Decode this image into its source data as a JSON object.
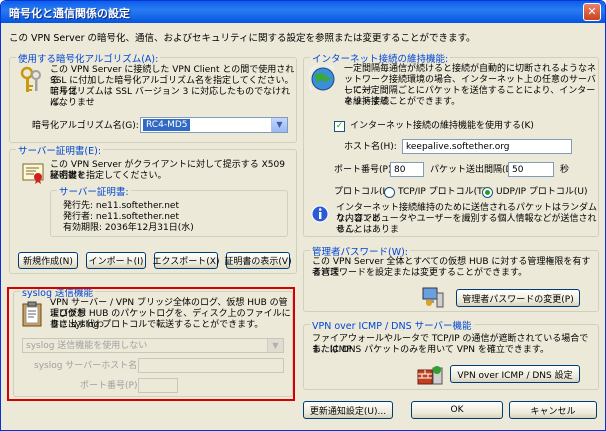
{
  "window": {
    "title": "暗号化と通信関係の設定",
    "close_glyph": "✕",
    "description": "この VPN Server の暗号化、通信、およびセキュリティに関する設定を参照または変更することができます。"
  },
  "encryption": {
    "group_title": "使用する暗号化アルゴリズム(A):",
    "text": [
      "この VPN Server に接続した VPN Client との間で使用される",
      "SSL に付加した暗号化アルゴリズム名を指定してください。暗号化",
      "アルゴリズムは SSL バージョン 3 に対応したものでなければなりませ",
      "ん。"
    ],
    "algorithm_label": "暗号化アルゴリズム名(G):",
    "algorithm_value": "RC4-MD5"
  },
  "certificate": {
    "group_title": "サーバー証明書(E):",
    "text": [
      "この VPN Server がクライアントに対して提示する X509 証明書と",
      "秘密鍵を指定してください。"
    ],
    "subgroup_title": "サーバー証明書:",
    "issued_to": "発行先: ne11.softether.net",
    "issuer": "発行者: ne11.softether.net",
    "expires": "有効期限: 2036年12月31日(水)",
    "buttons": [
      "新規作成(N)",
      "インポート(I)",
      "エクスポート(X)",
      "証明書の表示(V)"
    ]
  },
  "syslog": {
    "group_title": "syslog 送信機能",
    "text": [
      "VPN サーバー / VPN ブリッジ全体のログ、仮想 HUB の管理ログお",
      "よび仮想 HUB のパケットログを、ディスク上のファイルに書き出す代わ",
      "りに syslog プロトコルで転送することができます。"
    ],
    "mode_value": "syslog 送信機能を使用しない",
    "host_label": "syslog サーバーホスト名(S):",
    "host_value": "",
    "port_label": "ポート番号(P):",
    "port_value": ""
  },
  "keepalive": {
    "group_title": "インターネット接続の維持機能:",
    "text": [
      "一定間隔毎通信が続けると接続が自動的に切断されるようなネ",
      "ットワーク接続環境の場合、インターネット上の任意のサーバーに対",
      "して一定間隔ごとにパケットを送信することにより、インターネット接続",
      "を維持することができます。"
    ],
    "checkbox_label": "インターネット接続の維持機能を使用する(K)",
    "checked_glyph": "✓",
    "host_label": "ホスト名(H):",
    "host_value": "keepalive.softether.org",
    "port_label": "ポート番号(P):",
    "port_value": "80",
    "interval_label": "パケット送出間隔(D):",
    "interval_value": "50",
    "interval_unit": "秒",
    "protocol_label": "プロトコル(L):",
    "tcp_label": "TCP/IP プロトコル(T)",
    "udp_label": "UDP/IP プロトコル(U)",
    "note": [
      "インターネット接続維持のために送信されるパケットはランダムな内容であ",
      "り、コンピュータやユーザーを識別する個人情報などが送信されることはありま",
      "せん。"
    ]
  },
  "admin": {
    "group_title": "管理者パスワード(W):",
    "text": [
      "この VPN Server 全体とすべての仮想 HUB に対する管理権限を有する管理",
      "者パスワードを設定または変更することができます。"
    ],
    "button": "管理者パスワードの変更(P)"
  },
  "vpnicmp": {
    "group_title": "VPN over ICMP / DNS サーバー機能",
    "text": [
      "ファイアウォールやルータで TCP/IP の通信が遮断されている場合でも、ICMP",
      "または DNS パケットのみを用いて VPN を確立できます。"
    ],
    "button": "VPN over ICMP / DNS 設定"
  },
  "footer": {
    "update_button": "更新通知設定(U)...",
    "ok_button": "OK",
    "cancel_button": "キャンセル"
  }
}
